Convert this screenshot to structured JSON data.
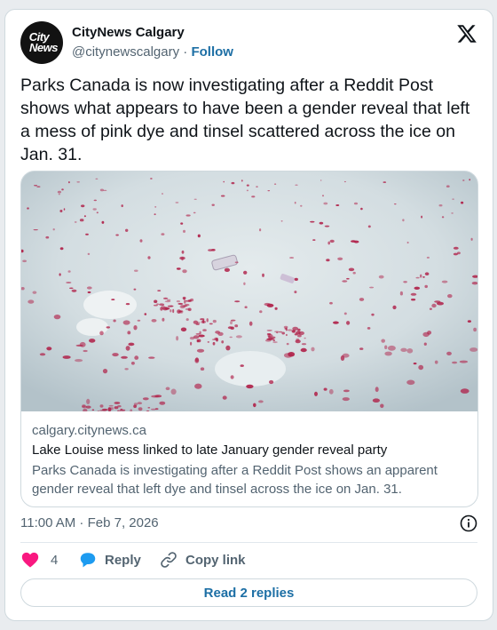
{
  "author": {
    "avatar_text_line1": "City",
    "avatar_text_line2": "News",
    "name": "CityNews Calgary",
    "handle": "@citynewscalgary",
    "separator": "·",
    "follow_label": "Follow"
  },
  "tweet": {
    "text": "Parks Canada is now investigating after a Reddit Post shows what appears to have been a gender reveal that left a mess of pink dye and tinsel scattered across the ice on Jan. 31."
  },
  "link_card": {
    "domain": "calgary.citynews.ca",
    "title": "Lake Louise mess linked to late January gender reveal party",
    "description": "Parks Canada is investigating after a Reddit Post shows an apparent gender reveal that left dye and tinsel across the ice on Jan. 31."
  },
  "meta": {
    "timestamp": "11:00 AM · Feb 7, 2026"
  },
  "actions": {
    "like_count": "4",
    "reply_label": "Reply",
    "copy_label": "Copy link"
  },
  "replies_button": {
    "label": "Read 2 replies"
  },
  "colors": {
    "link_blue": "#1d6fa5",
    "like_pink": "#f91880",
    "reply_blue": "#1d9bf0",
    "muted": "#536471",
    "stain": "#b0224a"
  },
  "icons": {
    "x_logo": "x-logo-icon",
    "info": "info-icon",
    "like": "heart-icon",
    "reply": "speech-bubble-icon",
    "copy": "link-icon"
  }
}
